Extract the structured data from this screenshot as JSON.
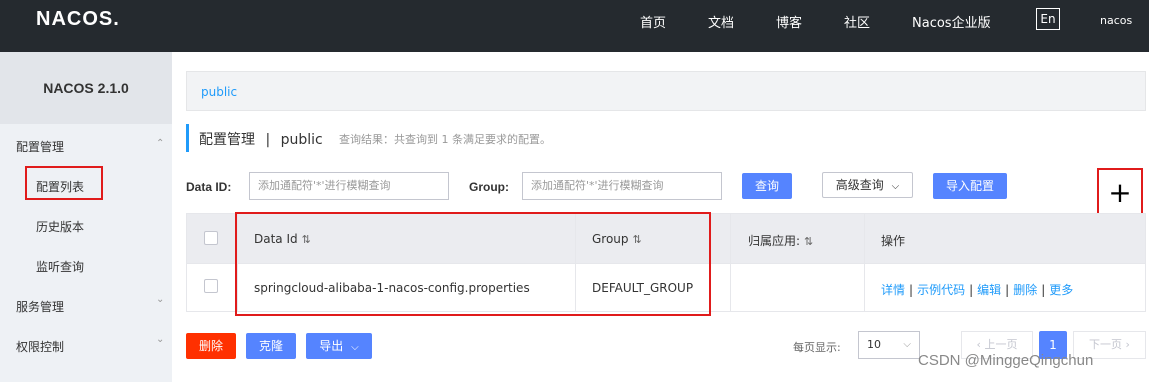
{
  "nav": {
    "logo": "NACOS.",
    "items": [
      "首页",
      "文档",
      "博客",
      "社区",
      "Nacos企业版"
    ],
    "lang": "En",
    "user": "nacos"
  },
  "sidebar": {
    "version": "NACOS 2.1.0",
    "groups": [
      {
        "label": "配置管理",
        "items": [
          "配置列表",
          "历史版本",
          "监听查询"
        ]
      },
      {
        "label": "服务管理"
      },
      {
        "label": "权限控制"
      }
    ],
    "arrow_up": "⌃",
    "arrow_down": "⌄"
  },
  "breadcrumb": "public",
  "page": {
    "title": "配置管理",
    "sep": "|",
    "namespace": "public",
    "result": "查询结果：共查询到 1 条满足要求的配置。"
  },
  "search": {
    "dataid_label": "Data ID:",
    "dataid_placeholder": "添加通配符'*'进行模糊查询",
    "group_label": "Group:",
    "group_placeholder": "添加通配符'*'进行模糊查询",
    "query_btn": "查询",
    "advanced_btn": "高级查询",
    "import_btn": "导入配置",
    "add_btn": "+"
  },
  "table": {
    "headers": [
      "Data Id",
      "Group",
      "归属应用:",
      "操作"
    ],
    "sort_icon": "⇅",
    "rows": [
      {
        "data_id": "springcloud-alibaba-1-nacos-config.properties",
        "group": "DEFAULT_GROUP",
        "app": "",
        "ops": [
          "详情",
          "示例代码",
          "编辑",
          "删除",
          "更多"
        ]
      }
    ]
  },
  "bottom": {
    "delete_btn": "删除",
    "clone_btn": "克隆",
    "export_btn": "导出",
    "page_size_label": "每页显示:",
    "page_size": "10",
    "prev": "上一页",
    "page": "1",
    "next": "下一页"
  },
  "watermark": "CSDN @MinggeQingchun",
  "colors": {
    "topbar": "#252a2f",
    "primary": "#5584ff",
    "link": "#209bfa",
    "danger": "#ff3000",
    "highlight": "#e01b1b"
  }
}
